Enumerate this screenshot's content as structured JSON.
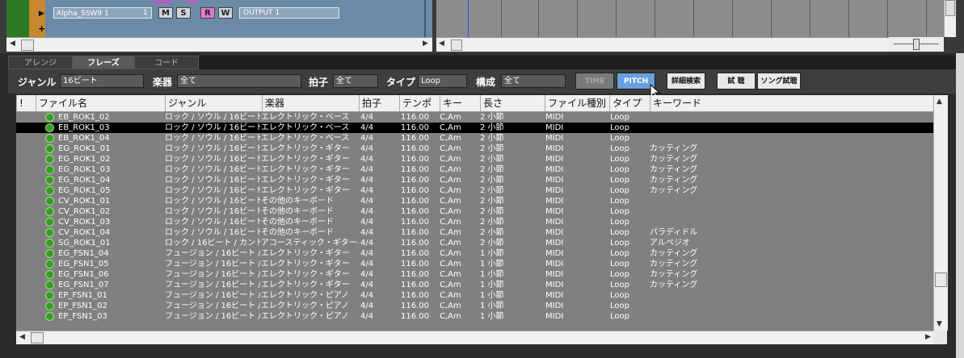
{
  "colors": {
    "track_strip": "#2a7a22",
    "track_number": "#c8882e",
    "record_button": "#e07ad0",
    "pitch_button": "#6aa0e0",
    "playhead": "#3050d0",
    "list_bg": "#7e8180",
    "selected_row": "#000000"
  },
  "track": {
    "name": "Alpha_SSW9 1",
    "number": "1",
    "mute": "M",
    "solo": "S",
    "record": "R",
    "write": "W",
    "output": "OUTPUT 1",
    "scroll_left": "◀",
    "scroll_right": "▶"
  },
  "tabs": [
    "アレンジ",
    "フレーズ",
    "コード"
  ],
  "filter": {
    "genre_label": "ジャンル",
    "genre_value": "16ビート",
    "instrument_label": "楽器",
    "instrument_value": "全て",
    "meter_label": "拍子",
    "meter_value": "全て",
    "type_label": "タイプ",
    "type_value": "Loop",
    "structure_label": "構成",
    "structure_value": "全て",
    "time_button": "TIME",
    "pitch_button": "PITCH",
    "detail_search_button": "詳細検索",
    "audition_button": "試 聴",
    "song_audition_button": "ソング試聴"
  },
  "list": {
    "columns": [
      "!",
      "ファイル名",
      "ジャンル",
      "楽器",
      "拍子",
      "テンポ",
      "キー",
      "長さ",
      "ファイル種別",
      "タイプ",
      "キーワード"
    ],
    "rows": [
      {
        "name": "EB_ROK1_02",
        "genre": "ロック / ソウル / 16ビート ...",
        "inst": "エレクトリック・ベース",
        "meter": "4/4",
        "tempo": "116.00",
        "key": "C,Am",
        "len": "2 小節",
        "ftype": "MIDI",
        "type": "Loop",
        "kw": ""
      },
      {
        "name": "EB_ROK1_03",
        "genre": "ロック / ソウル / 16ビート ...",
        "inst": "エレクトリック・ベース",
        "meter": "4/4",
        "tempo": "116.00",
        "key": "C,Am",
        "len": "2 小節",
        "ftype": "MIDI",
        "type": "Loop",
        "kw": ""
      },
      {
        "name": "EB_ROK1_04",
        "genre": "ロック / ソウル / 16ビート ...",
        "inst": "エレクトリック・ベース",
        "meter": "4/4",
        "tempo": "116.00",
        "key": "C,Am",
        "len": "2 小節",
        "ftype": "MIDI",
        "type": "Loop",
        "kw": ""
      },
      {
        "name": "EG_ROK1_01",
        "genre": "ロック / ソウル / 16ビート",
        "inst": "エレクトリック・ギター",
        "meter": "4/4",
        "tempo": "116.00",
        "key": "C,Am",
        "len": "2 小節",
        "ftype": "MIDI",
        "type": "Loop",
        "kw": "カッティング"
      },
      {
        "name": "EG_ROK1_02",
        "genre": "ロック / ソウル / 16ビート",
        "inst": "エレクトリック・ギター",
        "meter": "4/4",
        "tempo": "116.00",
        "key": "C,Am",
        "len": "2 小節",
        "ftype": "MIDI",
        "type": "Loop",
        "kw": "カッティング"
      },
      {
        "name": "EG_ROK1_03",
        "genre": "ロック / ソウル / 16ビート ...",
        "inst": "エレクトリック・ギター",
        "meter": "4/4",
        "tempo": "116.00",
        "key": "C,Am",
        "len": "2 小節",
        "ftype": "MIDI",
        "type": "Loop",
        "kw": "カッティング"
      },
      {
        "name": "EG_ROK1_04",
        "genre": "ロック / ソウル / 16ビート",
        "inst": "エレクトリック・ギター",
        "meter": "4/4",
        "tempo": "116.00",
        "key": "C,Am",
        "len": "2 小節",
        "ftype": "MIDI",
        "type": "Loop",
        "kw": "カッティング"
      },
      {
        "name": "EG_ROK1_05",
        "genre": "ロック / ソウル / 16ビート",
        "inst": "エレクトリック・ギター",
        "meter": "4/4",
        "tempo": "116.00",
        "key": "C,Am",
        "len": "2 小節",
        "ftype": "MIDI",
        "type": "Loop",
        "kw": "カッティング"
      },
      {
        "name": "CV_ROK1_01",
        "genre": "ロック / ソウル / 16ビート ...",
        "inst": "その他のキーボード",
        "meter": "4/4",
        "tempo": "116.00",
        "key": "C,Am",
        "len": "2 小節",
        "ftype": "MIDI",
        "type": "Loop",
        "kw": ""
      },
      {
        "name": "CV_ROK1_02",
        "genre": "ロック / ソウル / 16ビート ...",
        "inst": "その他のキーボード",
        "meter": "4/4",
        "tempo": "116.00",
        "key": "C,Am",
        "len": "2 小節",
        "ftype": "MIDI",
        "type": "Loop",
        "kw": ""
      },
      {
        "name": "CV_ROK1_03",
        "genre": "ロック / ソウル / 16ビート ...",
        "inst": "その他のキーボード",
        "meter": "4/4",
        "tempo": "116.00",
        "key": "C,Am",
        "len": "2 小節",
        "ftype": "MIDI",
        "type": "Loop",
        "kw": ""
      },
      {
        "name": "CV_ROK1_04",
        "genre": "ロック / ソウル / 16ビート ...",
        "inst": "その他のキーボード",
        "meter": "4/4",
        "tempo": "116.00",
        "key": "C,Am",
        "len": "2 小節",
        "ftype": "MIDI",
        "type": "Loop",
        "kw": "パラディドル"
      },
      {
        "name": "SG_ROK1_01",
        "genre": "ロック / 16ビート / カントリー",
        "inst": "アコースティック・ギター(スチー...",
        "meter": "4/4",
        "tempo": "116.00",
        "key": "C,Am",
        "len": "2 小節",
        "ftype": "MIDI",
        "type": "Loop",
        "kw": "アルペジオ"
      },
      {
        "name": "EG_FSN1_04",
        "genre": "フュージョン / 16ビート / A...",
        "inst": "エレクトリック・ギター",
        "meter": "4/4",
        "tempo": "116.00",
        "key": "C,Am",
        "len": "1 小節",
        "ftype": "MIDI",
        "type": "Loop",
        "kw": "カッティング"
      },
      {
        "name": "EG_FSN1_05",
        "genre": "フュージョン / 16ビート / A...",
        "inst": "エレクトリック・ギター",
        "meter": "4/4",
        "tempo": "116.00",
        "key": "C,Am",
        "len": "1 小節",
        "ftype": "MIDI",
        "type": "Loop",
        "kw": "カッティング"
      },
      {
        "name": "EG_FSN1_06",
        "genre": "フュージョン / 16ビート / A...",
        "inst": "エレクトリック・ギター",
        "meter": "4/4",
        "tempo": "116.00",
        "key": "C,Am",
        "len": "1 小節",
        "ftype": "MIDI",
        "type": "Loop",
        "kw": "カッティング"
      },
      {
        "name": "EG_FSN1_07",
        "genre": "フュージョン / 16ビート / A...",
        "inst": "エレクトリック・ギター",
        "meter": "4/4",
        "tempo": "116.00",
        "key": "C,Am",
        "len": "1 小節",
        "ftype": "MIDI",
        "type": "Loop",
        "kw": "カッティング"
      },
      {
        "name": "EP_FSN1_01",
        "genre": "フュージョン / 16ビート / ソ...",
        "inst": "エレクトリック・ピアノ",
        "meter": "4/4",
        "tempo": "116.00",
        "key": "C,Am",
        "len": "1 小節",
        "ftype": "MIDI",
        "type": "Loop",
        "kw": ""
      },
      {
        "name": "EP_FSN1_02",
        "genre": "フュージョン / 16ビート / ソ...",
        "inst": "エレクトリック・ピアノ",
        "meter": "4/4",
        "tempo": "116.00",
        "key": "C,Am",
        "len": "1 小節",
        "ftype": "MIDI",
        "type": "Loop",
        "kw": ""
      },
      {
        "name": "EP_FSN1_03",
        "genre": "フュージョン / 16ビート / ソ...",
        "inst": "エレクトリック・ピアノ",
        "meter": "4/4",
        "tempo": "116.00",
        "key": "C,Am",
        "len": "1 小節",
        "ftype": "MIDI",
        "type": "Loop",
        "kw": ""
      }
    ],
    "selected_index": 1
  },
  "scroll": {
    "left_arrow": "◀",
    "right_arrow": "▶",
    "up_arrow": "▲",
    "down_arrow": "▼"
  }
}
